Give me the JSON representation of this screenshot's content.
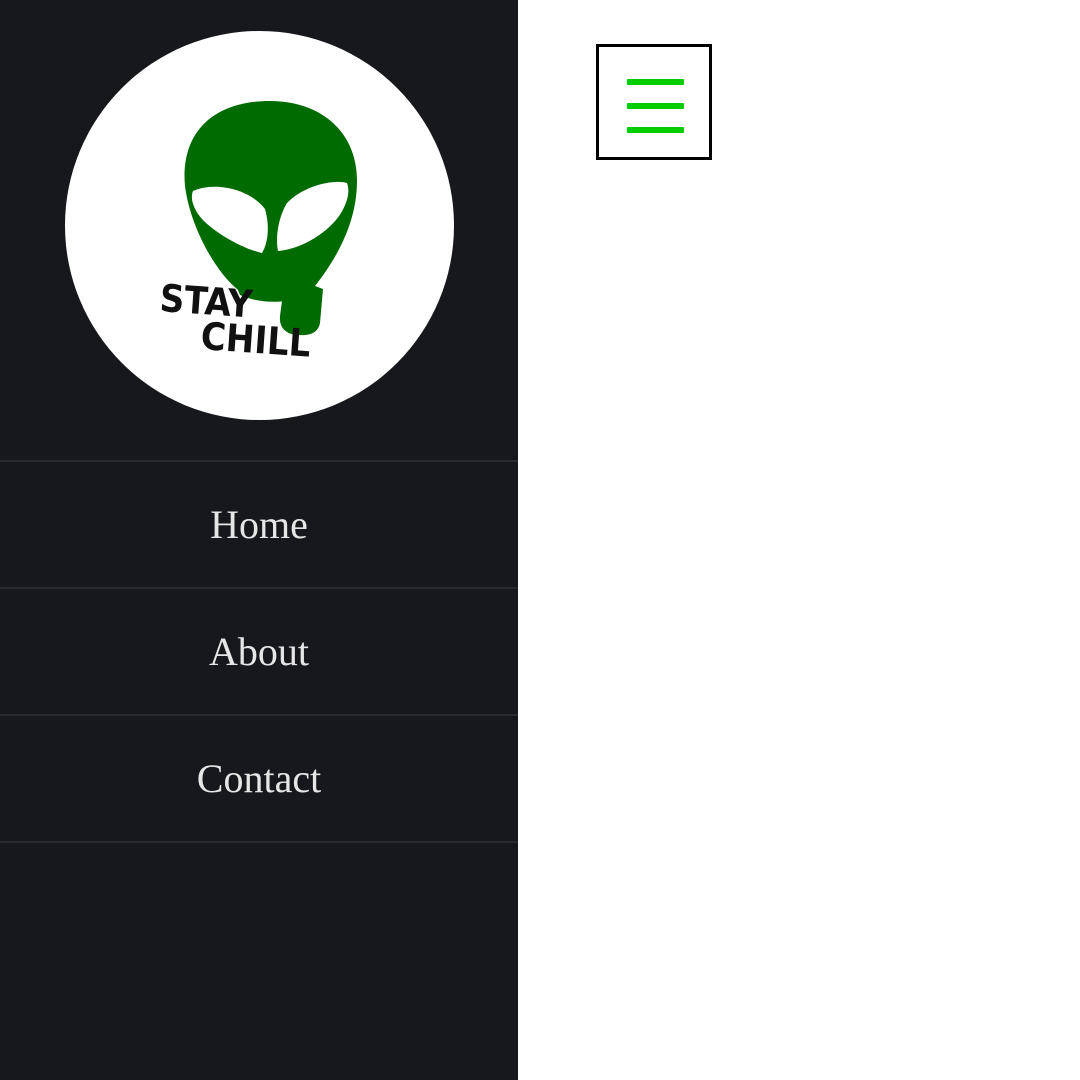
{
  "logo": {
    "line1": "STAY",
    "line2": "CHILL",
    "icon": "alien-head-logo",
    "color": "#006b00"
  },
  "nav": {
    "items": [
      {
        "label": "Home"
      },
      {
        "label": "About"
      },
      {
        "label": "Contact"
      }
    ]
  },
  "menu_toggle": {
    "icon": "hamburger-menu-icon",
    "color": "#00cc00"
  },
  "colors": {
    "sidebar_bg": "#17181b",
    "nav_text": "#e6e6e6",
    "divider": "#2a2b2f",
    "page_bg": "#ffffff"
  }
}
